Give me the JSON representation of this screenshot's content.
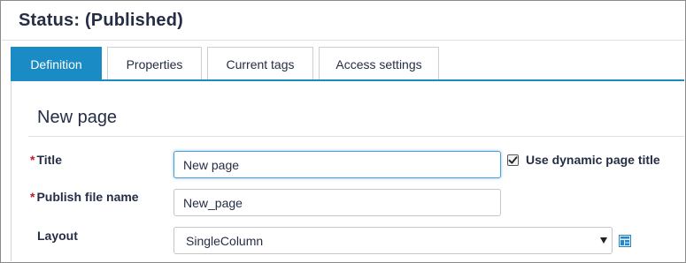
{
  "header": {
    "status_title": "Status: (Published)"
  },
  "tabs": [
    {
      "label": "Definition",
      "active": true
    },
    {
      "label": "Properties",
      "active": false
    },
    {
      "label": "Current tags",
      "active": false
    },
    {
      "label": "Access settings",
      "active": false
    }
  ],
  "section": {
    "title": "New page"
  },
  "form": {
    "title_field": {
      "required_marker": "*",
      "label": "Title",
      "value": "New page"
    },
    "dynamic_title": {
      "label": "Use dynamic page title",
      "checked": true
    },
    "publish_file_name": {
      "required_marker": "*",
      "label": "Publish file name",
      "value": "New_page"
    },
    "layout": {
      "label": "Layout",
      "selected": "SingleColumn",
      "icon": "layout-edit-icon"
    }
  },
  "colors": {
    "accent": "#1a8bc4",
    "required": "#c0192a",
    "text": "#262e45"
  }
}
